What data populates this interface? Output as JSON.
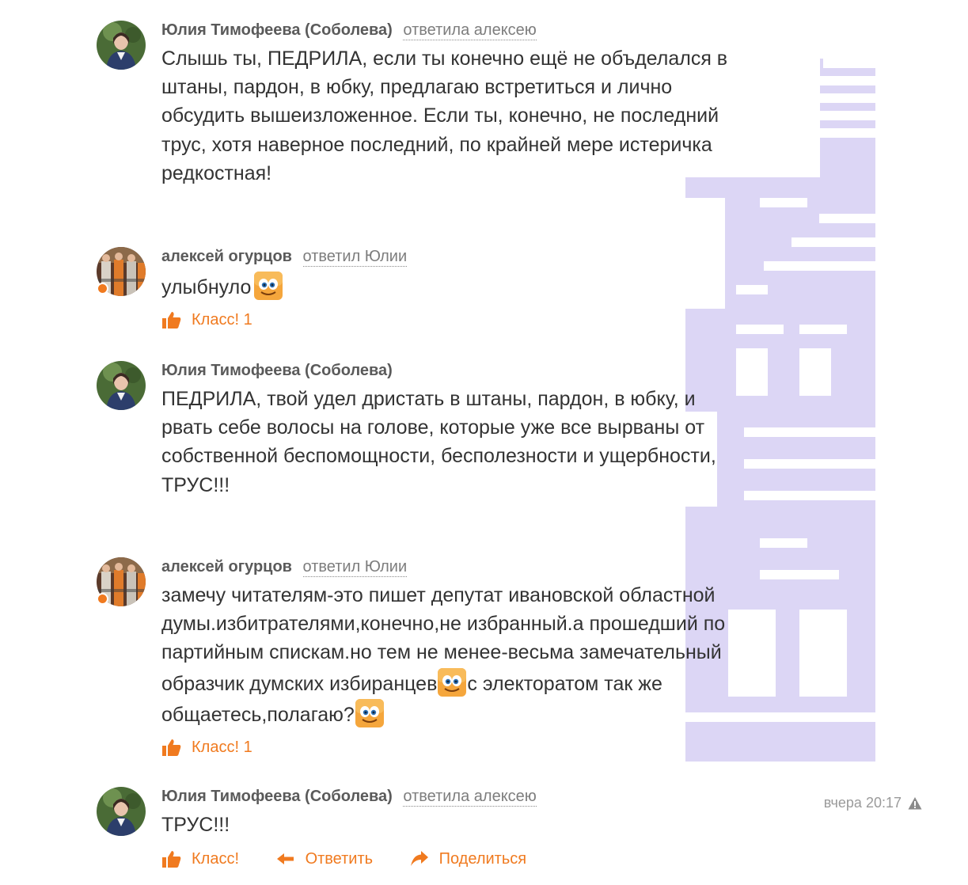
{
  "comments": [
    {
      "author": "Юлия Тимофеева (Соболева)",
      "reply_to": "ответила алексею",
      "lines": [
        "Слышь ты, ПЕДРИЛА, если ты конечно ещё не объделался в",
        "штаны, пардон, в юбку, предлагаю встретиться и лично",
        "обсудить вышеизложенное. Если ты, конечно, не последний",
        "трус, хотя наверное последний, по крайней мере истеричка",
        "редкостная!"
      ]
    },
    {
      "author": "алексей огурцов",
      "reply_to": "ответил Юлии",
      "text": "улыбнуло",
      "emoji": "smiley-emoji",
      "like_label": "Класс!",
      "like_count": "1"
    },
    {
      "author": "Юлия Тимофеева (Соболева)",
      "lines": [
        "ПЕДРИЛА, твой удел дристать в штаны, пардон, в юбку, и",
        "рвать себе волосы на голове, которые уже все вырваны от",
        "собственной беспомощности, бесполезности и ущербности,",
        "ТРУС!!!"
      ]
    },
    {
      "author": "алексей огурцов",
      "reply_to": "ответил Юлии",
      "lines": [
        "замечу читателям-это пишет депутат ивановской областной",
        "думы.избитрателями,конечно,не избранный.а прошедший по",
        "партийным спискам.но тем не менее-весьма замечательный"
      ],
      "line4_a": "образчик думских избиранцев",
      "line4_b": "с электоратом так же",
      "line5": "общаетесь,полагаю?",
      "like_label": "Класс!",
      "like_count": "1"
    },
    {
      "author": "Юлия Тимофеева (Соболева)",
      "reply_to": "ответила алексею",
      "text": "ТРУС!!!",
      "timestamp": "вчера 20:17",
      "like_label": "Класс!",
      "reply_label": "Ответить",
      "share_label": "Поделиться"
    }
  ],
  "colors": {
    "accent": "#f07a1f",
    "author": "#5a5a5a",
    "text": "#333333",
    "watermark": "#dcd6f5"
  },
  "icons": [
    "thumbs-up-icon",
    "reply-arrow-icon",
    "share-arrow-icon",
    "warning-icon",
    "smiley-emoji",
    "online-dot"
  ],
  "watermark_text": "BAZA"
}
